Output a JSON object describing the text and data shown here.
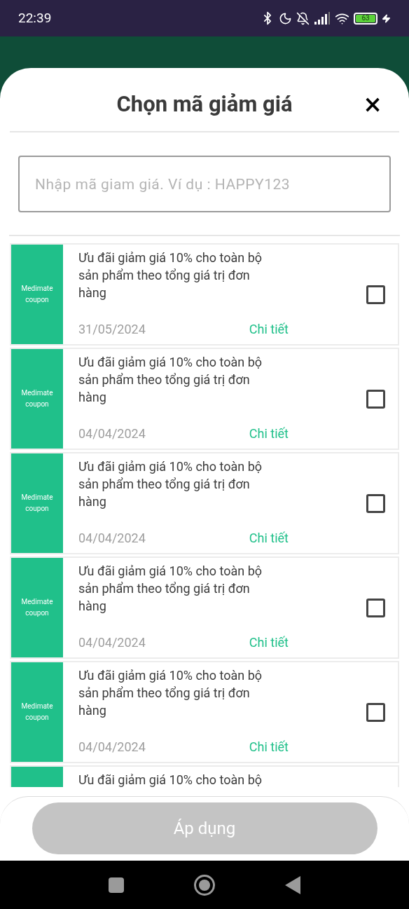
{
  "status_bar": {
    "time": "22:39",
    "battery": "63"
  },
  "sheet": {
    "title": "Chọn mã giảm giá",
    "close": "×"
  },
  "code_field": {
    "placeholder": "Nhập mã giam giá. Ví dụ : HAPPY123"
  },
  "coupons": [
    {
      "badge": "Medimate coupon",
      "description": "Ưu đãi giảm giá 10% cho toàn bộ sản phẩm theo tổng giá trị đơn hàng",
      "date": "31/05/2024",
      "link": "Chi tiết",
      "checked": false
    },
    {
      "badge": "Medimate coupon",
      "description": "Ưu đãi giảm giá 10% cho toàn bộ sản phẩm theo tổng giá trị đơn hàng",
      "date": "04/04/2024",
      "link": "Chi tiết",
      "checked": false
    },
    {
      "badge": "Medimate coupon",
      "description": "Ưu đãi giảm giá 10% cho toàn bộ sản phẩm theo tổng giá trị đơn hàng",
      "date": "04/04/2024",
      "link": "Chi tiết",
      "checked": false
    },
    {
      "badge": "Medimate coupon",
      "description": "Ưu đãi giảm giá 10% cho toàn bộ sản phẩm theo tổng giá trị đơn hàng",
      "date": "04/04/2024",
      "link": "Chi tiết",
      "checked": false
    },
    {
      "badge": "Medimate coupon",
      "description": "Ưu đãi giảm giá 10% cho toàn bộ sản phẩm theo tổng giá trị đơn hàng",
      "date": "04/04/2024",
      "link": "Chi tiết",
      "checked": false
    },
    {
      "description": "Ưu đãi giảm giá 10% cho toàn bộ"
    }
  ],
  "apply_button": {
    "label": "Áp dụng",
    "disabled": true
  }
}
